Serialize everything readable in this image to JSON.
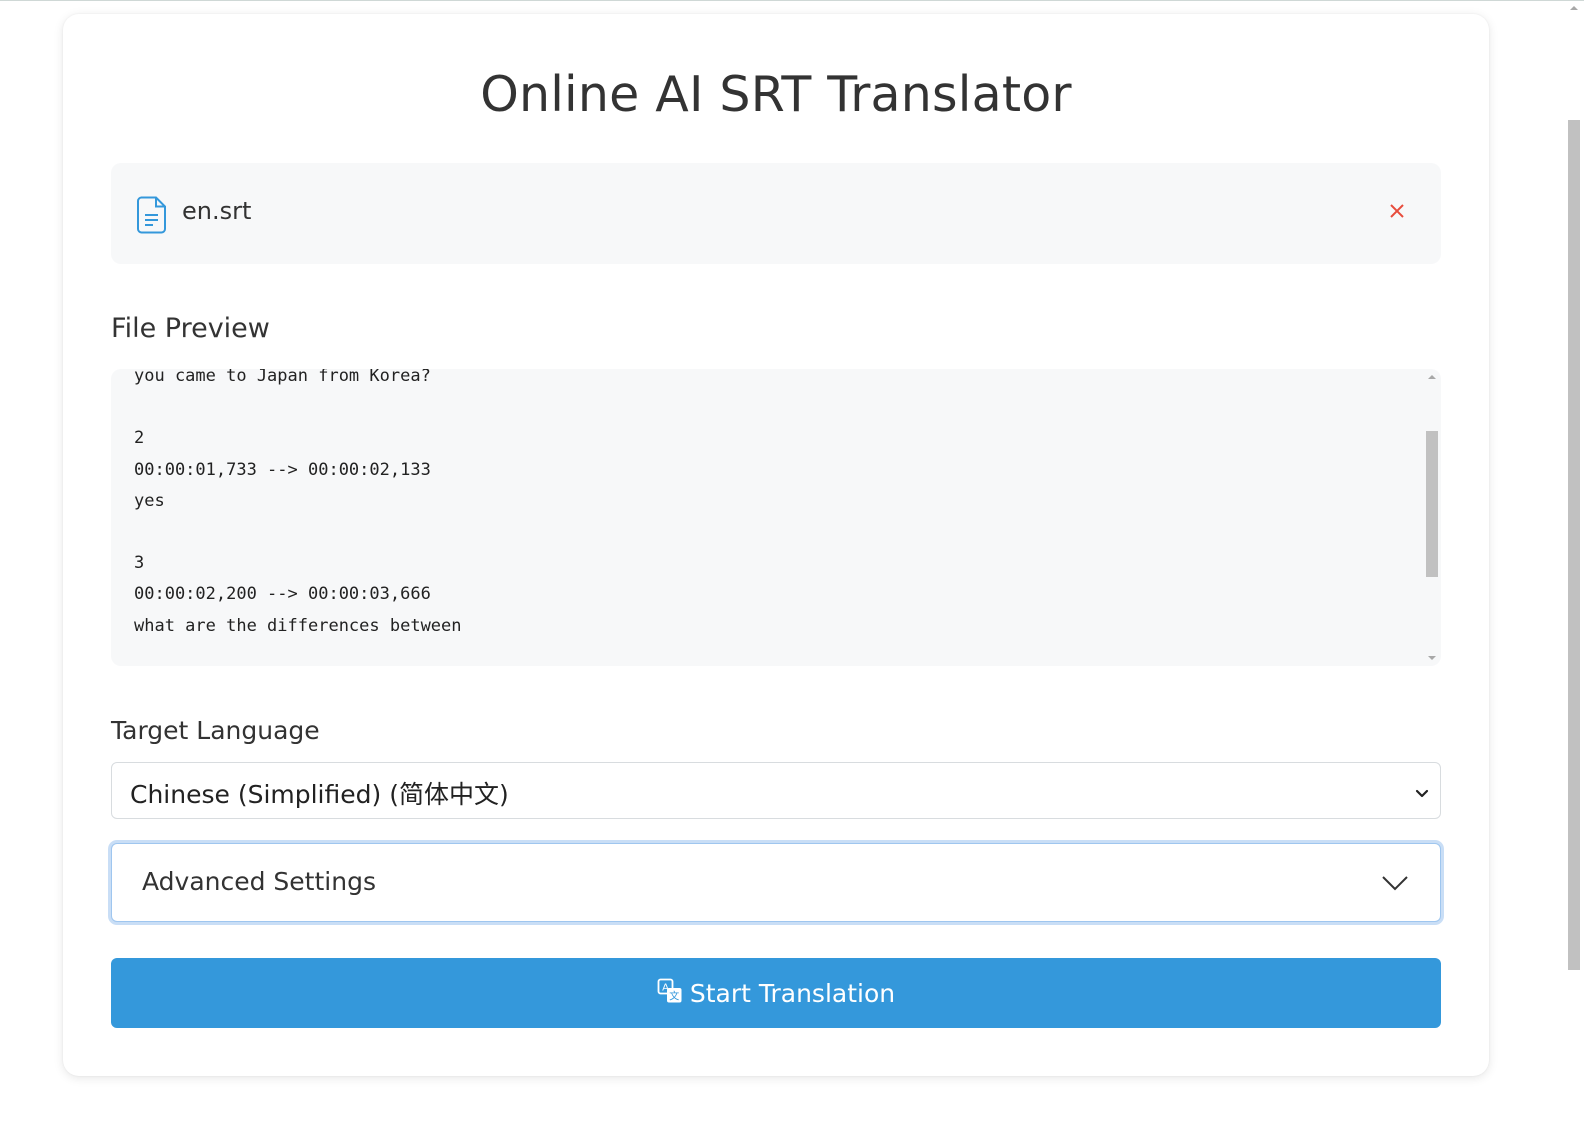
{
  "app": {
    "title": "Online AI SRT Translator"
  },
  "file": {
    "name": "en.srt",
    "file_icon": "file-text-icon",
    "remove_icon": "close-icon"
  },
  "preview": {
    "label": "File Preview",
    "lines": [
      "you came to Japan from Korea?",
      "",
      "2",
      "00:00:01,733 --> 00:00:02,133",
      "yes",
      "",
      "3",
      "00:00:02,200 --> 00:00:03,666",
      "what are the differences between"
    ]
  },
  "target_language": {
    "label": "Target Language",
    "selected": "Chinese (Simplified) (简体中文)"
  },
  "advanced": {
    "label": "Advanced Settings",
    "icon": "chevron-down-icon"
  },
  "start": {
    "label": "Start Translation",
    "icon": "translate-icon"
  },
  "colors": {
    "accent": "#3498db",
    "remove": "#e74c3c",
    "file_icon": "#3498db",
    "panel_bg": "#f7f8f9"
  }
}
